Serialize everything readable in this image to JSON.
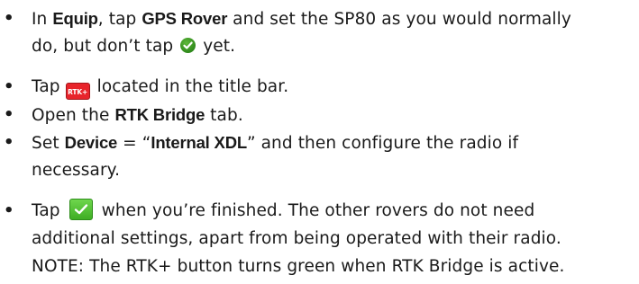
{
  "steps": [
    {
      "bullet": "•",
      "line1_a": "In ",
      "line1_b": "Equip",
      "line1_c": ", tap ",
      "line1_d": "GPS Rover",
      "line1_e": " and set the SP80 as you would normally",
      "line2_a": "do, but don’t tap ",
      "line2_b": " yet."
    },
    {
      "bullet": "•",
      "line1_a": "Tap ",
      "rtk_badge": "RTK+",
      "line1_b": " located in the title bar."
    },
    {
      "bullet": "•",
      "line1_a": "Open the ",
      "line1_b": "RTK Bridge",
      "line1_c": " tab."
    },
    {
      "bullet": "•",
      "line1_a": "Set ",
      "line1_b": "Device",
      "line1_c": " = “",
      "line1_d": "Internal XDL",
      "line1_e": "” and then configure the radio if",
      "line2_a": "necessary."
    },
    {
      "bullet": "•",
      "line1_a": "Tap ",
      "line1_b": " when you’re finished. The other rovers do not need",
      "line2_a": "additional settings, apart from being operated with their radio.",
      "note": "NOTE: The RTK+ button turns green when RTK Bridge is active."
    }
  ],
  "colors": {
    "check_green": "#2f8a1c",
    "rtk_red": "#e8242b",
    "ok_green": "#3fae24"
  },
  "icons": {
    "check_circle": "check-circle-icon",
    "rtk_plus": "rtk-plus-icon",
    "ok_button": "check-button-icon"
  }
}
